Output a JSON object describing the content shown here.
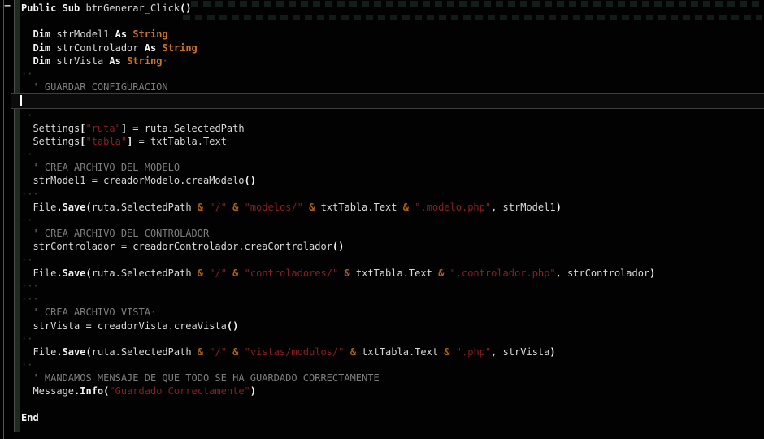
{
  "editor": {
    "language": "basic",
    "cursor_line": 8,
    "fold_marker": "−",
    "colors": {
      "background": "#020202",
      "default_text": "#d9d9d9",
      "keyword": "#f3f3f3",
      "type": "#cd7326",
      "string": "#8c1f1f",
      "comment": "#7e7e7e",
      "operator_amp": "#aa611e",
      "whitespace_dots": "#3d4744",
      "cursor_line_bg": "#0b0b0b",
      "cursor_line_border": "#3e3e3e",
      "fold_strip": "#1f2a21",
      "caret": "#ffffff"
    },
    "lines": [
      [
        [
          "kw",
          "Public Sub"
        ],
        [
          "id",
          " btnGenerar_Click"
        ],
        [
          "br",
          "()"
        ]
      ],
      [],
      [
        [
          "id",
          "  "
        ],
        [
          "kw",
          "Dim"
        ],
        [
          "id",
          " strModel1 "
        ],
        [
          "kw",
          "As "
        ],
        [
          "typ",
          "String"
        ]
      ],
      [
        [
          "id",
          "  "
        ],
        [
          "kw",
          "Dim"
        ],
        [
          "id",
          " strControlador "
        ],
        [
          "kw",
          "As "
        ],
        [
          "typ",
          "String"
        ]
      ],
      [
        [
          "id",
          "  "
        ],
        [
          "kw",
          "Dim"
        ],
        [
          "id",
          " strVista "
        ],
        [
          "kw",
          "As "
        ],
        [
          "typ",
          "String"
        ],
        [
          "wso",
          "·"
        ]
      ],
      [
        [
          "ws",
          "··"
        ]
      ],
      [
        [
          "id",
          "  "
        ],
        [
          "cm",
          "' GUARDAR CONFIGURACION"
        ]
      ],
      [],
      [
        [
          "ws",
          "··"
        ]
      ],
      [
        [
          "id",
          "  Settings"
        ],
        [
          "br",
          "["
        ],
        [
          "str",
          "\"ruta\""
        ],
        [
          "br",
          "]"
        ],
        [
          "id",
          " = ruta.SelectedPath"
        ]
      ],
      [
        [
          "id",
          "  Settings"
        ],
        [
          "br",
          "["
        ],
        [
          "str",
          "\"tabla\""
        ],
        [
          "br",
          "]"
        ],
        [
          "id",
          " = txtTabla.Text"
        ]
      ],
      [
        [
          "ws",
          "··"
        ]
      ],
      [
        [
          "id",
          "  "
        ],
        [
          "cm",
          "' CREA ARCHIVO DEL MODELO"
        ]
      ],
      [
        [
          "id",
          "  strModel1 = creadorModelo.creaModelo"
        ],
        [
          "br",
          "()"
        ]
      ],
      [
        [
          "ws",
          "···"
        ]
      ],
      [
        [
          "id",
          "  File"
        ],
        [
          "kw",
          ".Save"
        ],
        [
          "br",
          "("
        ],
        [
          "id",
          "ruta.SelectedPath "
        ],
        [
          "amp",
          "&"
        ],
        [
          "id",
          " "
        ],
        [
          "str",
          "\"/\""
        ],
        [
          "id",
          " "
        ],
        [
          "amp",
          "&"
        ],
        [
          "id",
          " "
        ],
        [
          "str",
          "\"modelos/\""
        ],
        [
          "id",
          " "
        ],
        [
          "amp",
          "&"
        ],
        [
          "id",
          " txtTabla.Text "
        ],
        [
          "amp",
          "&"
        ],
        [
          "id",
          " "
        ],
        [
          "str",
          "\".modelo.php\""
        ],
        [
          "id",
          ", strModel1"
        ],
        [
          "br",
          ")"
        ]
      ],
      [
        [
          "ws",
          "··"
        ]
      ],
      [
        [
          "id",
          "  "
        ],
        [
          "cm",
          "' CREA ARCHIVO DEL CONTROLADOR"
        ]
      ],
      [
        [
          "id",
          "  strControlador = creadorControlador.creaControlador"
        ],
        [
          "br",
          "()"
        ]
      ],
      [
        [
          "ws",
          "··"
        ]
      ],
      [
        [
          "id",
          "  File"
        ],
        [
          "kw",
          ".Save"
        ],
        [
          "br",
          "("
        ],
        [
          "id",
          "ruta.SelectedPath "
        ],
        [
          "amp",
          "&"
        ],
        [
          "id",
          " "
        ],
        [
          "str",
          "\"/\""
        ],
        [
          "id",
          " "
        ],
        [
          "amp",
          "&"
        ],
        [
          "id",
          " "
        ],
        [
          "str",
          "\"controladores/\""
        ],
        [
          "id",
          " "
        ],
        [
          "amp",
          "&"
        ],
        [
          "id",
          " txtTabla.Text "
        ],
        [
          "amp",
          "&"
        ],
        [
          "id",
          " "
        ],
        [
          "str",
          "\".controlador.php\""
        ],
        [
          "id",
          ", strControlador"
        ],
        [
          "br",
          ")"
        ]
      ],
      [
        [
          "ws",
          "···"
        ]
      ],
      [
        [
          "ws",
          "···"
        ]
      ],
      [
        [
          "id",
          "  "
        ],
        [
          "cm",
          "' CREA ARCHIVO VISTA"
        ],
        [
          "ws",
          "·"
        ]
      ],
      [
        [
          "id",
          "  strVista = creadorVista.creaVista"
        ],
        [
          "br",
          "()"
        ]
      ],
      [
        [
          "ws",
          "··"
        ]
      ],
      [
        [
          "id",
          "  File"
        ],
        [
          "kw",
          ".Save"
        ],
        [
          "br",
          "("
        ],
        [
          "id",
          "ruta.SelectedPath "
        ],
        [
          "amp",
          "&"
        ],
        [
          "id",
          " "
        ],
        [
          "str",
          "\"/\""
        ],
        [
          "id",
          " "
        ],
        [
          "amp",
          "&"
        ],
        [
          "id",
          " "
        ],
        [
          "str",
          "\"vistas/modulos/\""
        ],
        [
          "id",
          " "
        ],
        [
          "amp",
          "&"
        ],
        [
          "id",
          " txtTabla.Text "
        ],
        [
          "amp",
          "&"
        ],
        [
          "id",
          " "
        ],
        [
          "str",
          "\".php\""
        ],
        [
          "id",
          ", strVista"
        ],
        [
          "br",
          ")"
        ]
      ],
      [
        [
          "ws",
          "··"
        ]
      ],
      [
        [
          "id",
          "  "
        ],
        [
          "cm",
          "' MANDAMOS MENSAJE DE QUE TODO SE HA GUARDADO CORRECTAMENTE"
        ]
      ],
      [
        [
          "id",
          "  Message"
        ],
        [
          "kw",
          ".Info"
        ],
        [
          "br",
          "("
        ],
        [
          "str",
          "\"Guardado Correctamente\""
        ],
        [
          "br",
          ")"
        ]
      ],
      [],
      [
        [
          "kw",
          "End"
        ]
      ],
      []
    ]
  }
}
